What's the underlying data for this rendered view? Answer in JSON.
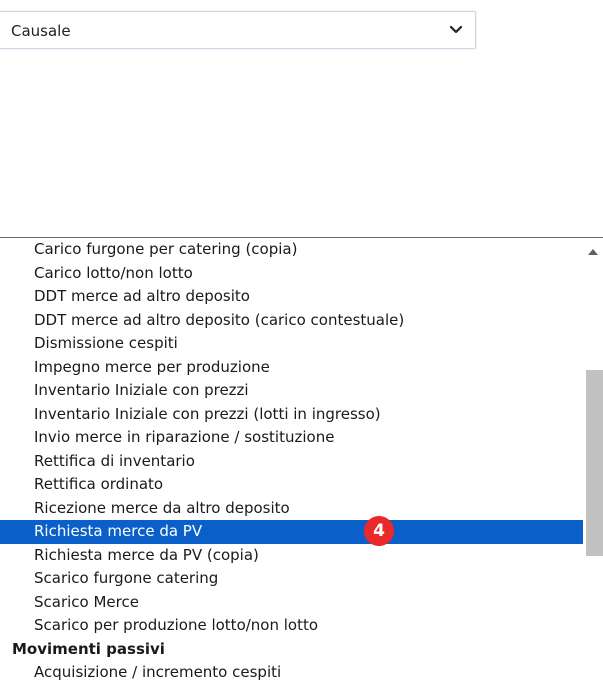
{
  "select": {
    "value": "Causale"
  },
  "dropdown": {
    "options": [
      {
        "label": "Carico furgone per catering (copia)"
      },
      {
        "label": "Carico lotto/non lotto"
      },
      {
        "label": "DDT merce ad altro deposito"
      },
      {
        "label": "DDT merce ad altro deposito (carico contestuale)"
      },
      {
        "label": "Dismissione cespiti"
      },
      {
        "label": "Impegno merce per produzione"
      },
      {
        "label": "Inventario Iniziale con prezzi"
      },
      {
        "label": "Inventario Iniziale con prezzi (lotti in ingresso)"
      },
      {
        "label": "Invio merce in riparazione / sostituzione"
      },
      {
        "label": "Rettifica di inventario"
      },
      {
        "label": "Rettifica ordinato"
      },
      {
        "label": "Ricezione merce da altro deposito"
      },
      {
        "label": "Richiesta merce da PV",
        "selected": true,
        "badge": "4"
      },
      {
        "label": "Richiesta merce da PV (copia)"
      },
      {
        "label": "Scarico furgone catering"
      },
      {
        "label": "Scarico Merce"
      },
      {
        "label": "Scarico per produzione lotto/non lotto"
      },
      {
        "label": "Movimenti passivi",
        "group": true
      },
      {
        "label": "Acquisizione / incremento cespiti"
      }
    ]
  },
  "colors": {
    "selected_bg": "#0a60c8",
    "badge_bg": "#ea2a2a"
  },
  "icons": {
    "select_chevron": "chevron-down-icon",
    "scroll_up": "triangle-up-icon"
  }
}
